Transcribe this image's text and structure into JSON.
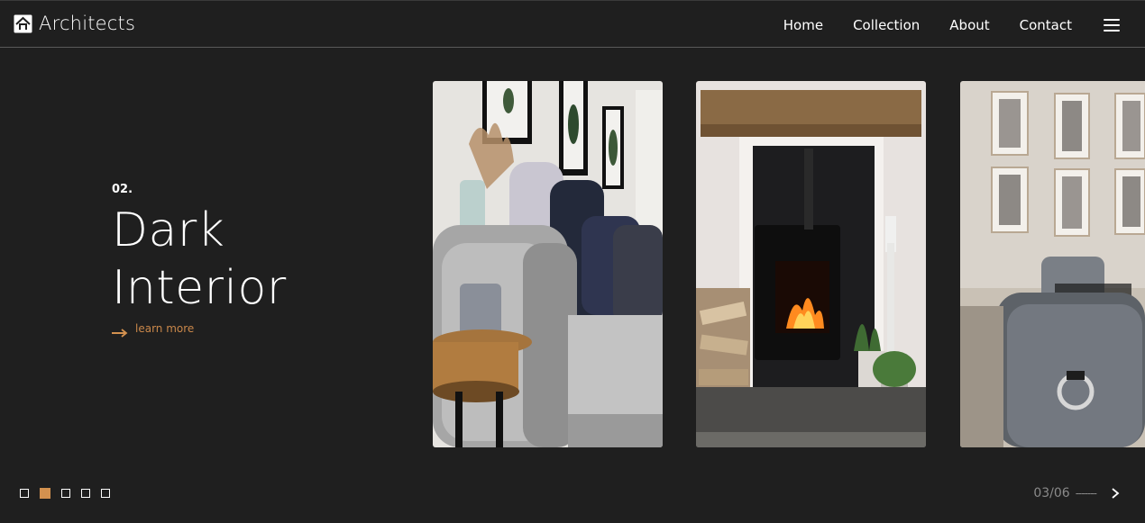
{
  "brand": {
    "name": "Architects",
    "icon": "house-icon"
  },
  "nav": {
    "items": [
      {
        "label": "Home"
      },
      {
        "label": "Collection"
      },
      {
        "label": "About"
      },
      {
        "label": "Contact"
      }
    ],
    "menu_icon": "hamburger-menu-icon"
  },
  "hero": {
    "number": "02.",
    "title_line1": "Dark",
    "title_line2": "Interior",
    "link_label": "learn more",
    "link_icon": "arrow-right-icon"
  },
  "cards": [
    {
      "name": "living-room-sofa-image"
    },
    {
      "name": "fireplace-image"
    },
    {
      "name": "dining-room-image"
    }
  ],
  "pagination": {
    "count": 5,
    "active_index": 1
  },
  "counter": {
    "text": "03/06",
    "dash": "-------",
    "next_icon": "chevron-right-icon"
  },
  "colors": {
    "background": "#1f1f1f",
    "accent": "#d3914f",
    "link": "#c9874a",
    "counter_text": "#8a8a8a"
  }
}
